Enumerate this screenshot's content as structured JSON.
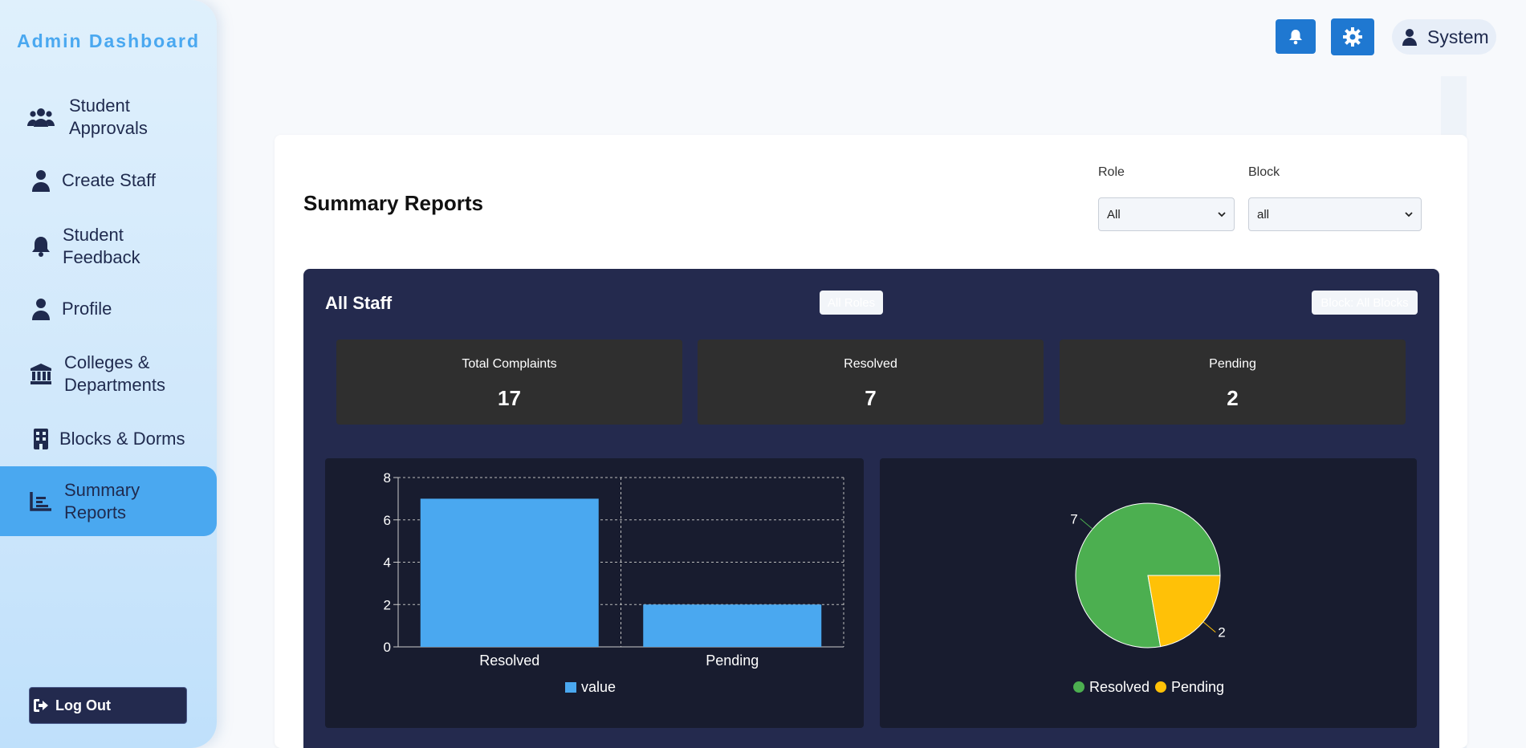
{
  "sidebar": {
    "brand": "Admin Dashboard",
    "items": [
      {
        "label": "Student Approvals",
        "icon": "users-icon"
      },
      {
        "label": "Create Staff",
        "icon": "user-icon"
      },
      {
        "label": "Student Feedback",
        "icon": "bell-icon"
      },
      {
        "label": "Profile",
        "icon": "user-icon"
      },
      {
        "label": "Colleges & Departments",
        "icon": "university-icon"
      },
      {
        "label": "Blocks & Dorms",
        "icon": "building-icon"
      },
      {
        "label": "Summary Reports",
        "icon": "chart-icon"
      }
    ],
    "active": "Summary Reports",
    "logout_label": "Log Out"
  },
  "header": {
    "user_name": "System",
    "icons": [
      "bell-icon",
      "gear-icon",
      "user-icon"
    ]
  },
  "filters": {
    "role_label": "Role",
    "role_value": "All",
    "block_label": "Block",
    "block_value": "all"
  },
  "report": {
    "title": "Summary Reports",
    "section_title": "All Staff",
    "role_chip": "All Roles",
    "block_chip": "Block: All Blocks",
    "stats": [
      {
        "label": "Total Complaints",
        "value": "17"
      },
      {
        "label": "Resolved",
        "value": "7"
      },
      {
        "label": "Pending",
        "value": "2"
      }
    ]
  },
  "colors": {
    "accent": "#4aa8f0",
    "primary_button": "#1f78d1",
    "dark_panel": "#242a4e",
    "resolved": "#4caf50",
    "pending": "#ffc107"
  },
  "chart_data": [
    {
      "type": "bar",
      "categories": [
        "Resolved",
        "Pending"
      ],
      "series": [
        {
          "name": "value",
          "values": [
            7,
            2
          ]
        }
      ],
      "yticks": [
        0,
        2,
        4,
        6,
        8
      ],
      "ylim": [
        0,
        8
      ],
      "grid": true,
      "legend": "bottom",
      "color": "#4aa8f0"
    },
    {
      "type": "pie",
      "labels": [
        "Resolved",
        "Pending"
      ],
      "values": [
        7,
        2
      ],
      "colors": [
        "#4caf50",
        "#ffc107"
      ],
      "legend": "bottom"
    }
  ]
}
